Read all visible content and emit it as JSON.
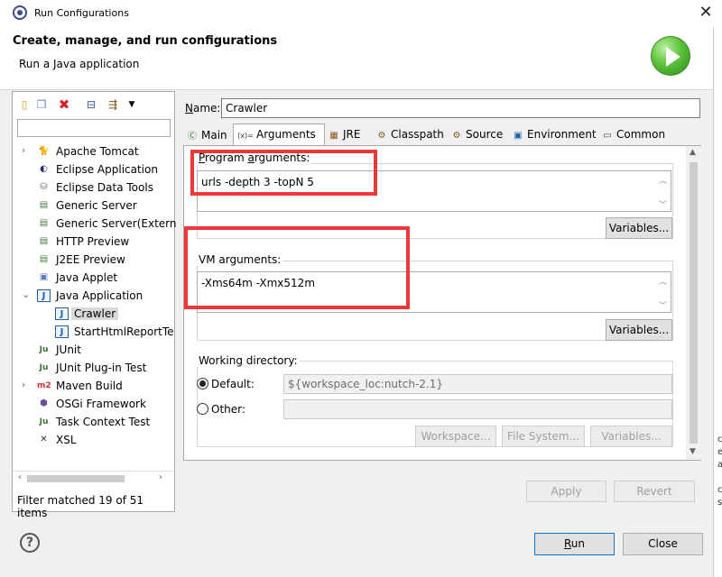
{
  "window": {
    "title": "Run Configurations",
    "close_icon": "close-icon"
  },
  "header": {
    "title": "Create, manage, and run configurations",
    "subtitle": "Run a Java application",
    "logo_icon": "run-icon"
  },
  "right_edge_fragments": [
    "c",
    "e",
    "a",
    "c",
    "s"
  ],
  "toolbar": {
    "icons": [
      "new-configuration-icon",
      "duplicate-icon",
      "delete-icon",
      "collapse-all-icon",
      "filter-icon",
      "view-menu-icon"
    ]
  },
  "filter": {
    "value": "",
    "status": "Filter matched 19 of 51 items"
  },
  "tree": {
    "items": [
      {
        "label": "Apache Tomcat",
        "icon": "tomcat-icon",
        "expandable": true,
        "level": 0
      },
      {
        "label": "Eclipse Application",
        "icon": "eclipse-icon",
        "expandable": false,
        "level": 0
      },
      {
        "label": "Eclipse Data Tools",
        "icon": "database-icon",
        "expandable": false,
        "level": 0
      },
      {
        "label": "Generic Server",
        "icon": "server-icon",
        "expandable": false,
        "level": 0
      },
      {
        "label": "Generic Server(Extern",
        "icon": "server-icon",
        "expandable": false,
        "level": 0
      },
      {
        "label": "HTTP Preview",
        "icon": "server-icon",
        "expandable": false,
        "level": 0
      },
      {
        "label": "J2EE Preview",
        "icon": "server-icon",
        "expandable": false,
        "level": 0
      },
      {
        "label": "Java Applet",
        "icon": "applet-icon",
        "expandable": false,
        "level": 0
      },
      {
        "label": "Java Application",
        "icon": "java-app-icon",
        "expandable": true,
        "expanded": true,
        "level": 0
      },
      {
        "label": "Crawler",
        "icon": "java-app-icon",
        "expandable": false,
        "level": 1,
        "selected": true
      },
      {
        "label": "StartHtmlReportTe",
        "icon": "java-app-icon",
        "expandable": false,
        "level": 1
      },
      {
        "label": "JUnit",
        "icon": "junit-icon",
        "expandable": false,
        "level": 0
      },
      {
        "label": "JUnit Plug-in Test",
        "icon": "junit-plugin-icon",
        "expandable": false,
        "level": 0
      },
      {
        "label": "Maven Build",
        "icon": "maven-icon",
        "expandable": true,
        "level": 0
      },
      {
        "label": "OSGi Framework",
        "icon": "osgi-icon",
        "expandable": false,
        "level": 0
      },
      {
        "label": "Task Context Test",
        "icon": "junit-icon",
        "expandable": false,
        "level": 0
      },
      {
        "label": "XSL",
        "icon": "xsl-icon",
        "expandable": false,
        "level": 0
      }
    ]
  },
  "config": {
    "name_label": "Name:",
    "name_value": "Crawler"
  },
  "tabs": [
    {
      "label": "Main",
      "icon": "main-tab-icon",
      "active": false
    },
    {
      "label": "Arguments",
      "icon": "arguments-tab-icon",
      "active": true
    },
    {
      "label": "JRE",
      "icon": "jre-tab-icon",
      "active": false
    },
    {
      "label": "Classpath",
      "icon": "classpath-tab-icon",
      "active": false
    },
    {
      "label": "Source",
      "icon": "source-tab-icon",
      "active": false
    },
    {
      "label": "Environment",
      "icon": "environment-tab-icon",
      "active": false
    },
    {
      "label": "Common",
      "icon": "common-tab-icon",
      "active": false
    }
  ],
  "arguments": {
    "program_label": "Program arguments:",
    "program_value": "urls -depth 3 -topN 5",
    "vm_label": "VM arguments:",
    "vm_value": "-Xms64m -Xmx512m",
    "variables_button": "Variables...",
    "annotation_color": "#ee3838"
  },
  "working_dir": {
    "label": "Working directory:",
    "default_label": "Default:",
    "default_value": "${workspace_loc:nutch-2.1}",
    "other_label": "Other:",
    "other_value": "",
    "default_checked": true,
    "workspace_button": "Workspace...",
    "filesystem_button": "File System...",
    "variables_button": "Variables..."
  },
  "actions": {
    "apply": "Apply",
    "revert": "Revert",
    "run": "Run",
    "close": "Close",
    "help_icon": "help-icon"
  }
}
